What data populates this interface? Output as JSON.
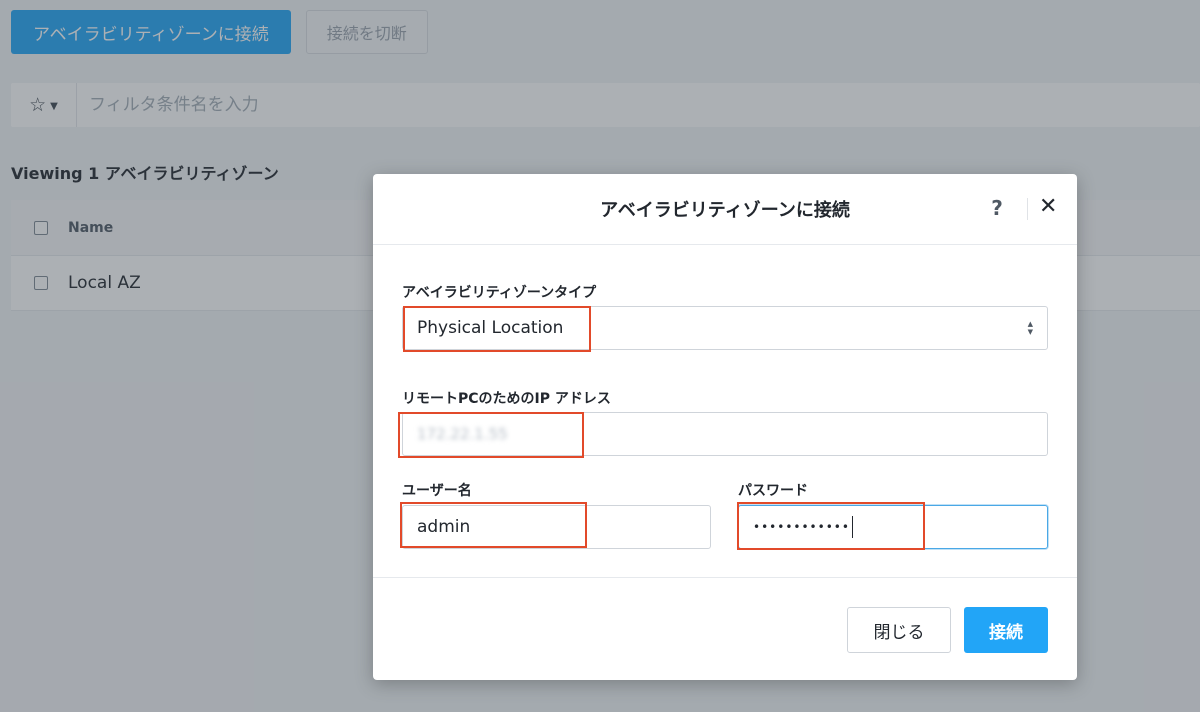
{
  "toolbar": {
    "connect_az_label": "アベイラビリティゾーンに接続",
    "disconnect_label": "接続を切断"
  },
  "filter": {
    "favorites_icon": "star-icon",
    "placeholder": "フィルタ条件名を入力"
  },
  "listing": {
    "viewing_label": "Viewing 1 アベイラビリティゾーン",
    "columns": [
      "Name"
    ],
    "rows": [
      {
        "name": "Local AZ"
      }
    ]
  },
  "modal": {
    "title": "アベイラビリティゾーンに接続",
    "help_label": "?",
    "close_label": "✕",
    "az_type": {
      "label": "アベイラビリティゾーンタイプ",
      "selected": "Physical Location"
    },
    "remote_ip": {
      "label": "リモートPCのためのIP アドレス",
      "value": "172.22.1.55"
    },
    "username": {
      "label": "ユーザー名",
      "value": "admin"
    },
    "password": {
      "label": "パスワード",
      "masked_value": "••••••••••••"
    },
    "buttons": {
      "close": "閉じる",
      "connect": "接続"
    }
  },
  "colors": {
    "primary": "#22a5f7",
    "highlight_box": "#e24a2a",
    "overlay": "#3a424c"
  }
}
